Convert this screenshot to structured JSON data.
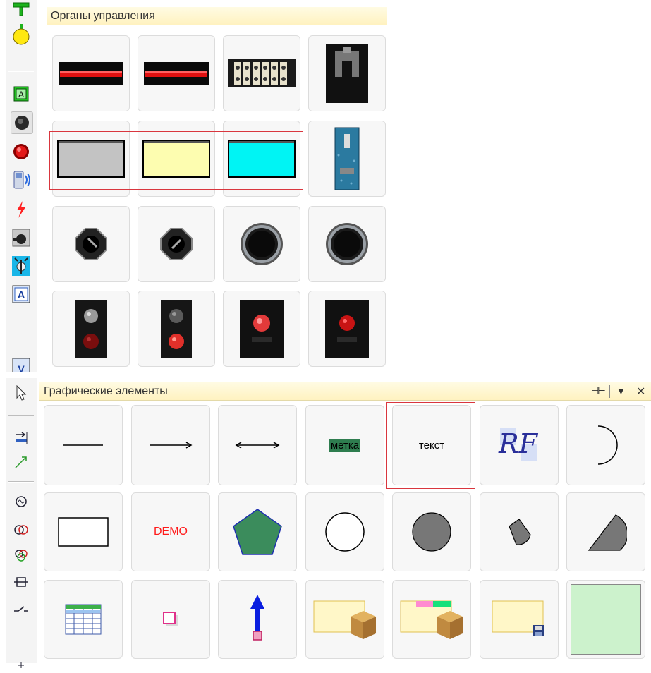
{
  "controls_panel": {
    "title": "Органы управления",
    "sidebar_icons": [
      "green-connector-icon",
      "yellow-bulb-icon",
      "green-a-indicator-icon",
      "black-button-icon",
      "red-button-icon",
      "phone-signal-icon",
      "lightning-icon",
      "rotary-switch-icon",
      "key-switch-icon",
      "a-text-icon",
      "v-text-icon"
    ],
    "tiles": [
      {
        "name": "horizontal-indicator-red-1",
        "kind": "hbar"
      },
      {
        "name": "horizontal-indicator-red-2",
        "kind": "hbar"
      },
      {
        "name": "terminal-block",
        "kind": "terminal"
      },
      {
        "name": "toggle-switch-black",
        "kind": "toggle"
      },
      {
        "name": "rect-gray",
        "kind": "rect",
        "color": "#c3c3c3"
      },
      {
        "name": "rect-yellow",
        "kind": "rect",
        "color": "#fdfdb0"
      },
      {
        "name": "rect-cyan",
        "kind": "rect",
        "color": "#00f4f4"
      },
      {
        "name": "vertical-switch-blue",
        "kind": "vswitch"
      },
      {
        "name": "octagon-knob-1",
        "kind": "octknob"
      },
      {
        "name": "octagon-knob-2",
        "kind": "octknob"
      },
      {
        "name": "round-button-1",
        "kind": "roundbtn"
      },
      {
        "name": "round-button-2",
        "kind": "roundbtn"
      },
      {
        "name": "two-lamp-panel-1",
        "kind": "twolamp",
        "top": "#9a9a9a",
        "bottom": "#7a0e0e"
      },
      {
        "name": "two-lamp-panel-2",
        "kind": "twolamp",
        "top": "#5a5a5a",
        "bottom": "#e0302a"
      },
      {
        "name": "single-lamp-panel-1",
        "kind": "onelamp",
        "lamp": "#e23a3a"
      },
      {
        "name": "single-lamp-panel-2",
        "kind": "onelamp",
        "lamp": "#c81414"
      }
    ]
  },
  "graphics_panel": {
    "title": "Графические элементы",
    "header_controls": [
      "pin-icon",
      "dropdown-arrow-icon",
      "close-icon"
    ],
    "close_label": "✕",
    "dropdown_label": "▼",
    "pin_label": "⊣⊢",
    "sidebar_icons": [
      "pointer-icon",
      "align-icon",
      "line-arrow-icon",
      "circle-symbol-icon",
      "two-circles-icon",
      "three-circles-icon",
      "box-line-icon",
      "switch-line-icon"
    ],
    "label_tile_text": "метка",
    "text_tile_text": "текст",
    "demo_tile_text": "DEMO",
    "logo_text": "RF",
    "colors": {
      "label_bg": "#2e7d4f",
      "pentagon": "#3b8c5c",
      "demo": "#ff1a1a",
      "light_green": "#ccf2cc"
    }
  }
}
